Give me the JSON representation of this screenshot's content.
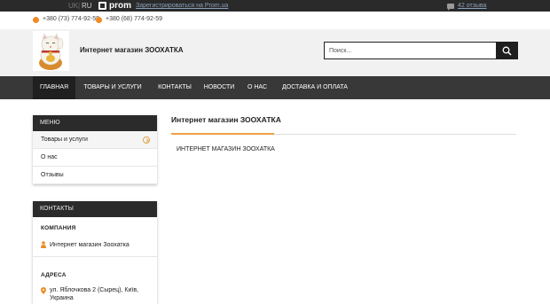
{
  "topbar": {
    "lang_uk": "UK",
    "lang_sep": "|",
    "lang_ru": "RU",
    "prom_logo_text": "prom",
    "register_link": "Зарегистрироваться на Prom.ua",
    "reviews_link": "42 отзыва"
  },
  "phones": [
    "+380 (73) 774-92-59",
    "+380 (68) 774-92-59"
  ],
  "header": {
    "shop_name": "Интернет магазин ЗООХАТКА",
    "search_placeholder": "Поиск..."
  },
  "nav": {
    "items": [
      "ГЛАВНАЯ",
      "ТОВАРЫ И УСЛУГИ",
      "КОНТАКТЫ",
      "НОВОСТИ",
      "О НАС",
      "ДОСТАВКА И ОПЛАТА"
    ]
  },
  "sidebar": {
    "menu_title": "МЕНЮ",
    "menu_items": [
      "Товары и услуги",
      "О нас",
      "Отзывы"
    ],
    "contacts_title": "КОНТАКТЫ",
    "company_label": "КОМПАНИЯ",
    "company_name": "Интернет магазин Зоохатка",
    "address_label": "АДРЕСА",
    "address": "ул. Яблочкова 2 (Сырец), Київ, Украина"
  },
  "main": {
    "title": "Интернет магазин ЗООХАТКА",
    "subtitle": "ИНТЕРНЕТ МАГАЗИН ЗООХАТКА"
  },
  "colors": {
    "accent": "#f0a045",
    "nav_bg": "#383838",
    "topbar_bg": "#2a2a2a"
  }
}
